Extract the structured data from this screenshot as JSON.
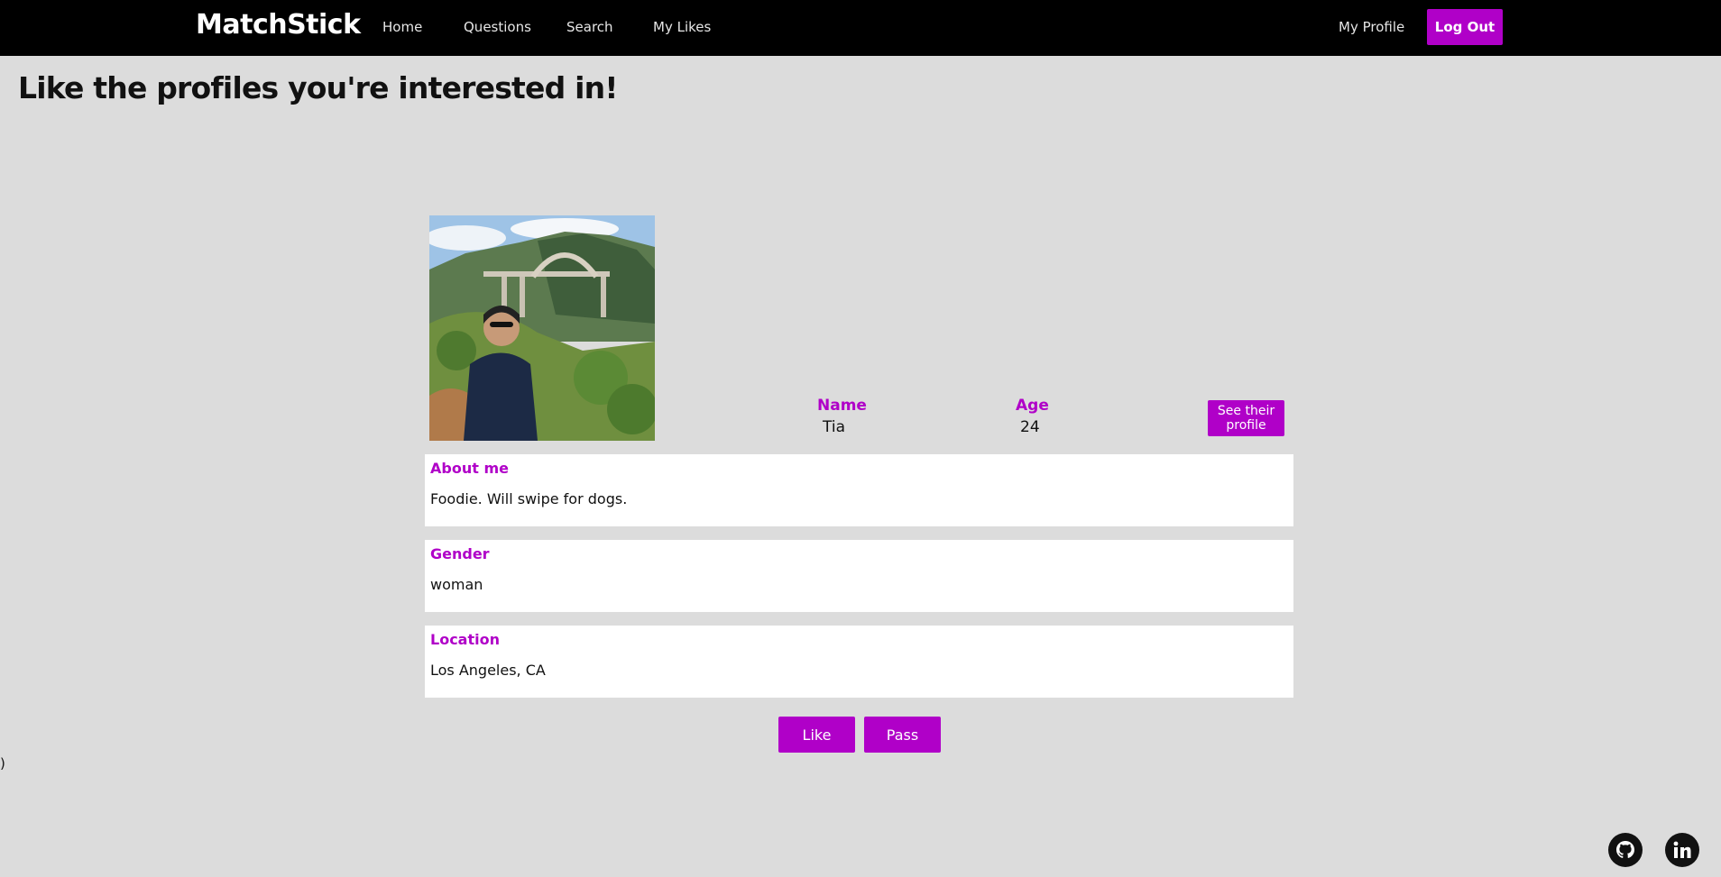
{
  "nav": {
    "brand": "MatchStick",
    "links": [
      "Home",
      "Questions",
      "Search",
      "My Likes"
    ],
    "my_profile": "My Profile",
    "logout": "Log Out"
  },
  "page_title": "Like the profiles you're interested in!",
  "profile": {
    "name_label": "Name",
    "name": "Tia",
    "age_label": "Age",
    "age": "24",
    "see_profile_button": "See their profile",
    "sections": [
      {
        "label": "About me",
        "value": "Foodie. Will swipe for dogs."
      },
      {
        "label": "Gender",
        "value": "woman"
      },
      {
        "label": "Location",
        "value": "Los Angeles, CA"
      }
    ]
  },
  "actions": {
    "like": "Like",
    "pass": "Pass"
  },
  "stray_text": ")",
  "footer": {
    "icons": [
      "github-icon",
      "linkedin-icon"
    ]
  },
  "colors": {
    "accent": "#b000c8",
    "navbar": "#000000",
    "background": "#dcdcdc"
  }
}
